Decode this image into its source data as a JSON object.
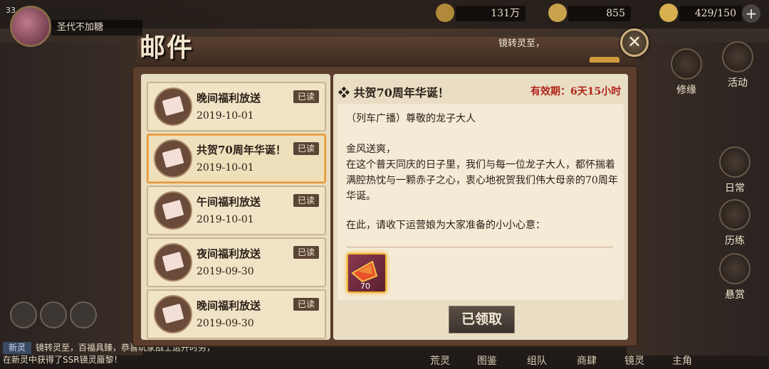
{
  "player": {
    "level": "33",
    "name": "圣代不加糖"
  },
  "resources": [
    {
      "icon": "coin-icon",
      "value": "131万"
    },
    {
      "icon": "swirl-currency-icon",
      "value": "855"
    },
    {
      "icon": "stamina-icon",
      "value": "429/150"
    }
  ],
  "side_menu": [
    {
      "label": "修缘"
    },
    {
      "label": "活动"
    },
    {
      "label": "日常"
    },
    {
      "label": "历练"
    },
    {
      "label": "悬赏"
    }
  ],
  "bottom_menu": [
    {
      "label": "荒灵"
    },
    {
      "label": "图鉴"
    },
    {
      "label": "组队"
    },
    {
      "label": "商肆"
    },
    {
      "label": "镜灵"
    },
    {
      "label": "主角"
    }
  ],
  "chat": {
    "tag": "新灵",
    "line1": "镜转灵至，百福具臻，恭喜玩家战士运开时劳，",
    "line2": "在新灵中获得了SSR镜灵蜃黎！"
  },
  "mail": {
    "title": "邮件",
    "marquee": "镜转灵至，",
    "close_symbol": "✕",
    "items": [
      {
        "title": "晚间福利放送",
        "date": "2019-10-01",
        "status": "已读"
      },
      {
        "title": "共贺70周年华诞！",
        "date": "2019-10-01",
        "status": "已读"
      },
      {
        "title": "午间福利放送",
        "date": "2019-10-01",
        "status": "已读"
      },
      {
        "title": "夜间福利放送",
        "date": "2019-09-30",
        "status": "已读"
      },
      {
        "title": "晚间福利放送",
        "date": "2019-09-30",
        "status": "已读"
      }
    ],
    "selected_index": 1,
    "detail": {
      "title": "共贺70周年华诞！",
      "validity": "有效期：6天15小时",
      "lines": [
        "（列车广播）尊敬的龙子大人",
        "",
        "金风送爽，",
        "在这个普天同庆的日子里，我们与每一位龙子大人，都怀揣着",
        "满腔热忱与一颗赤子之心，衷心地祝贺我们伟大母亲的70周年",
        "华诞。",
        "",
        "在此，请收下运营娘为大家准备的小小心意："
      ],
      "reward": {
        "icon": "red-crystal-icon",
        "count": "70"
      },
      "claim_label": "已领取"
    }
  }
}
